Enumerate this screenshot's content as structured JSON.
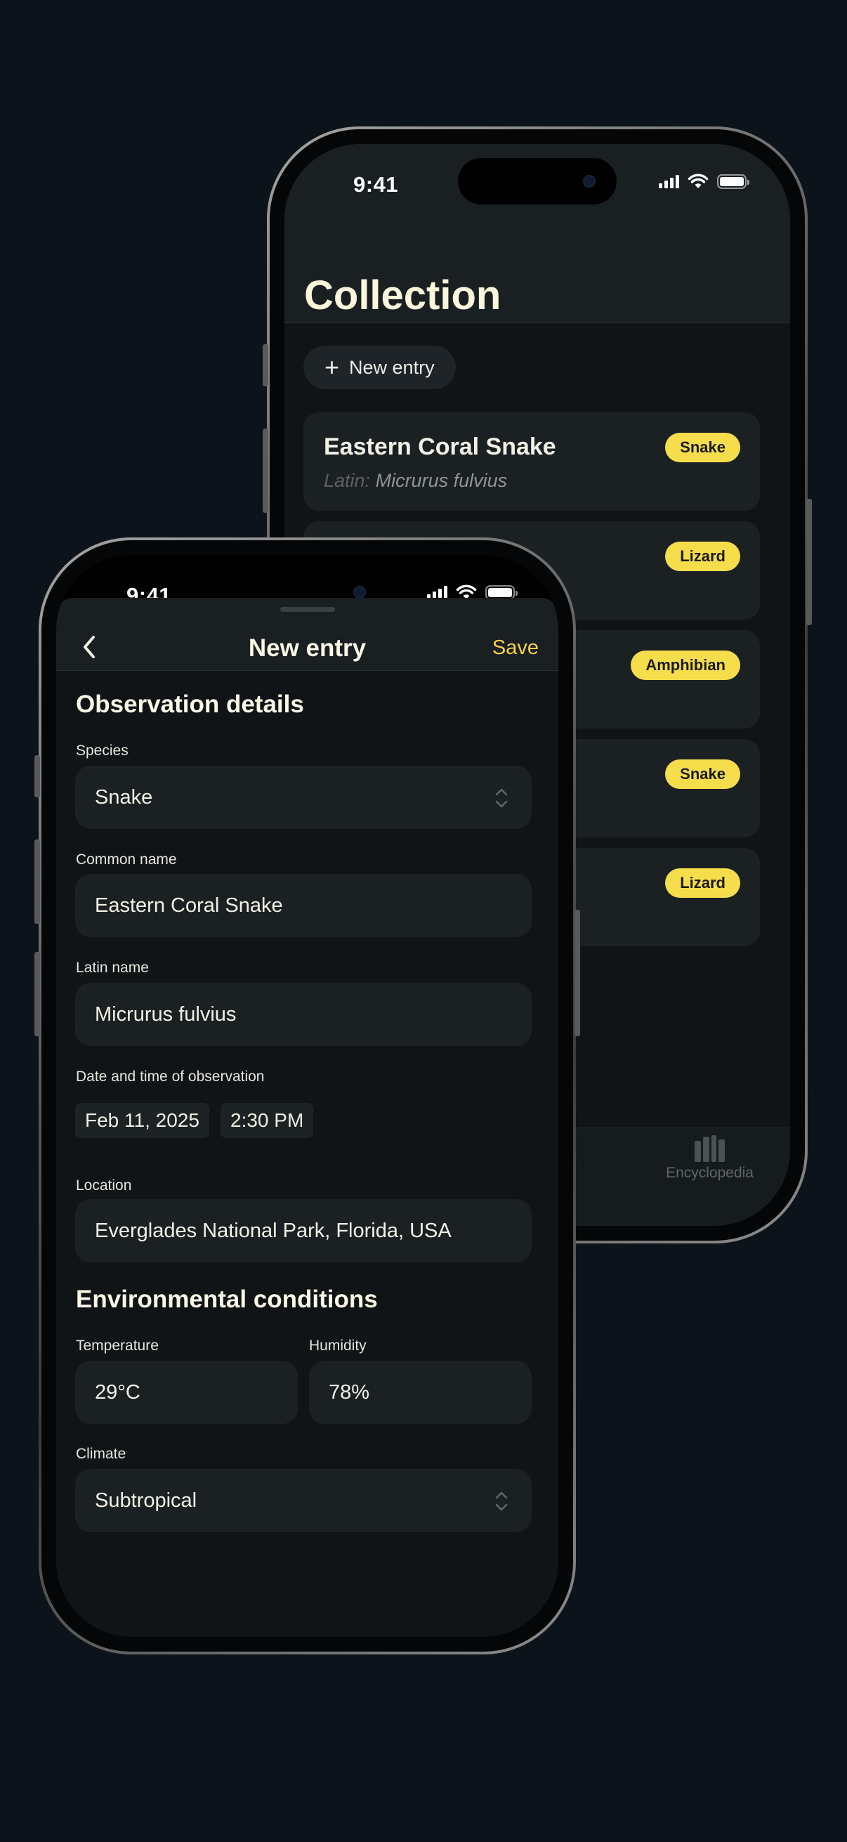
{
  "colors": {
    "background": "#0d131a",
    "accent": "#f4d448",
    "badge": "#f6dd4c",
    "card": "#1b2023"
  },
  "back_phone": {
    "status": {
      "time": "9:41"
    },
    "title": "Collection",
    "new_entry_label": "New entry",
    "entries": [
      {
        "name": "Eastern Coral Snake",
        "latin_prefix": "Latin:",
        "latin": "Micrurus fulvius",
        "badge": "Snake"
      },
      {
        "name": "",
        "latin_prefix": "",
        "latin": "",
        "badge": "Lizard"
      },
      {
        "name": "",
        "latin_prefix": "",
        "latin": "",
        "badge": "Amphibian"
      },
      {
        "name": "",
        "latin_prefix": "",
        "latin": "",
        "badge": "Snake"
      },
      {
        "name": "",
        "latin_prefix": "",
        "latin": "",
        "badge": "Lizard"
      }
    ],
    "tab_bar": {
      "encyclopedia_label": "Encyclopedia",
      "encyclopedia_icon": "books-icon"
    }
  },
  "front_phone": {
    "status": {
      "time": "9:41"
    },
    "header": {
      "title": "New entry",
      "save_label": "Save",
      "back_icon": "chevron-left-icon"
    },
    "observation": {
      "section_title": "Observation details",
      "species_label": "Species",
      "species_value": "Snake",
      "common_label": "Common name",
      "common_value": "Eastern Coral Snake",
      "latin_label": "Latin name",
      "latin_value": "Micrurus fulvius",
      "datetime_label": "Date and time of observation",
      "date_value": "Feb 11, 2025",
      "time_value": "2:30 PM",
      "location_label": "Location",
      "location_value": "Everglades National Park, Florida, USA"
    },
    "environment": {
      "section_title": "Environmental conditions",
      "temperature_label": "Temperature",
      "temperature_value": "29°C",
      "humidity_label": "Humidity",
      "humidity_value": "78%",
      "climate_label": "Climate",
      "climate_value": "Subtropical"
    }
  }
}
